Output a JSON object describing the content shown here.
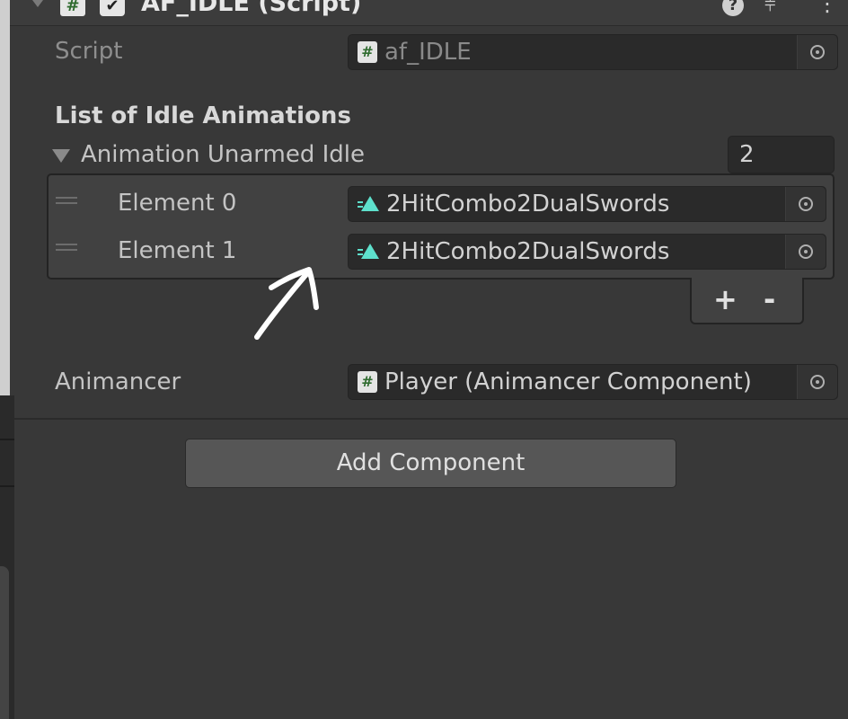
{
  "header": {
    "title": "AF_IDLE (Script)",
    "checkbox_checked": true,
    "icons": {
      "fold": "triangle-down-icon",
      "script": "script-hash-icon",
      "help": "help-icon",
      "presets": "presets-sliders-icon",
      "menu": "kebab-menu-icon"
    }
  },
  "script_field": {
    "label": "Script",
    "value": "af_IDLE"
  },
  "section_title": "List of Idle Animations",
  "list": {
    "label": "Animation Unarmed Idle",
    "count": "2",
    "elements": [
      {
        "label": "Element 0",
        "value": "2HitCombo2DualSwords"
      },
      {
        "label": "Element 1",
        "value": "2HitCombo2DualSwords"
      }
    ],
    "add_label": "+",
    "remove_label": "-"
  },
  "animancer_field": {
    "label": "Animancer",
    "value": "Player (Animancer Component)"
  },
  "add_component_label": "Add Component",
  "colors": {
    "background": "#383838",
    "field": "#2a2a2a",
    "clip_icon": "#5ee0cc",
    "annotation_arrow": "#ffffff"
  }
}
